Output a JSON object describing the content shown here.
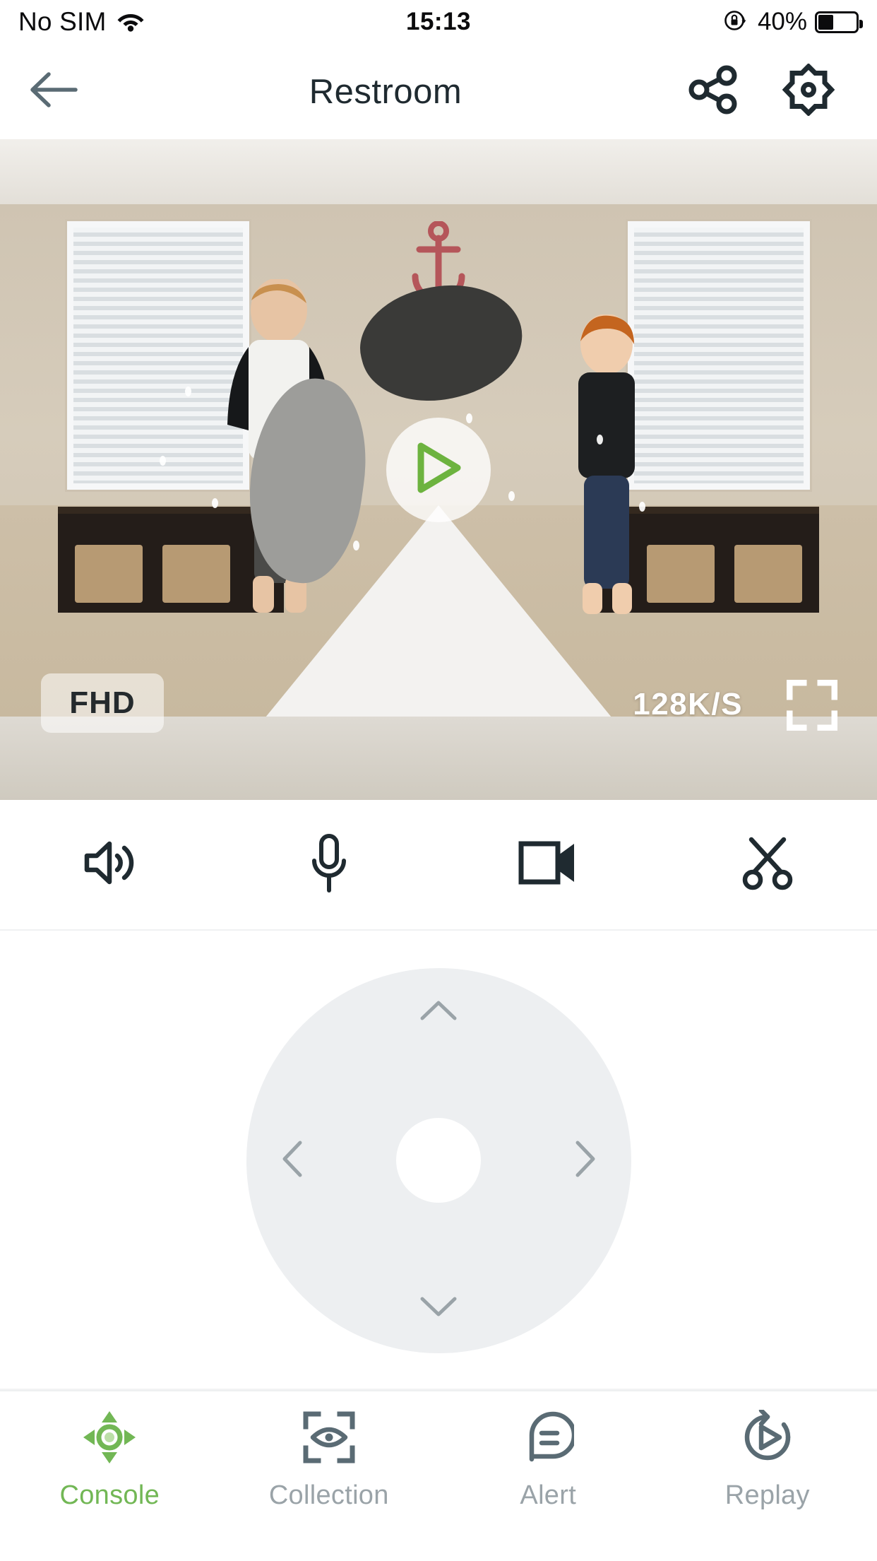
{
  "status_bar": {
    "carrier": "No SIM",
    "wifi_icon": "wifi-icon",
    "time": "15:13",
    "rotation_lock_icon": "rotation-lock-icon",
    "battery_percent": "40%",
    "battery_level": 40
  },
  "header": {
    "back_icon": "back-arrow-icon",
    "title": "Restroom",
    "share_icon": "share-icon",
    "settings_icon": "settings-gear-icon"
  },
  "video": {
    "play_icon": "play-triangle-icon",
    "quality_badge": "FHD",
    "bitrate": "128K/S",
    "fullscreen_icon": "fullscreen-expand-icon"
  },
  "toolbar": {
    "items": [
      {
        "name": "speaker-button",
        "icon": "speaker-volume-icon"
      },
      {
        "name": "microphone-button",
        "icon": "microphone-icon"
      },
      {
        "name": "record-button",
        "icon": "video-camera-icon"
      },
      {
        "name": "snapshot-button",
        "icon": "scissors-icon"
      }
    ]
  },
  "ptz": {
    "up_icon": "chevron-up-icon",
    "down_icon": "chevron-down-icon",
    "left_icon": "chevron-left-icon",
    "right_icon": "chevron-right-icon",
    "center_label": ""
  },
  "tabbar": {
    "active_index": 0,
    "items": [
      {
        "label": "Console",
        "icon": "dpad-joystick-icon"
      },
      {
        "label": "Collection",
        "icon": "eye-focus-frame-icon"
      },
      {
        "label": "Alert",
        "icon": "speech-bubble-icon"
      },
      {
        "label": "Replay",
        "icon": "replay-circular-arrow-icon"
      }
    ]
  },
  "colors": {
    "accent_green": "#72b755",
    "icon_dark": "#1f2a30",
    "tab_inactive": "#9aa3a8",
    "ptz_bg": "#edeff1"
  }
}
